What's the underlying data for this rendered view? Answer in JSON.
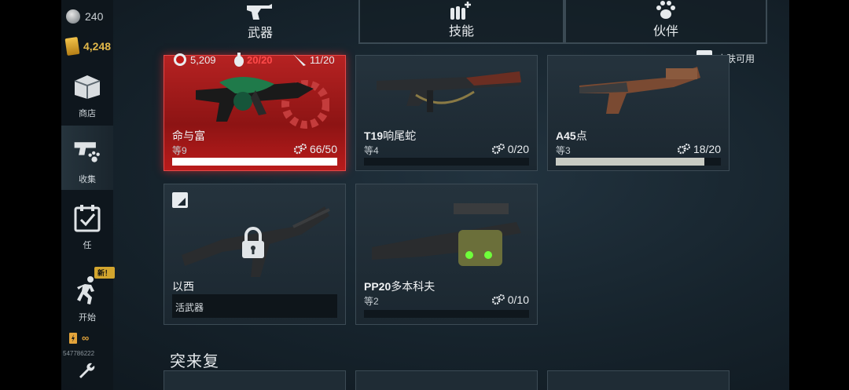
{
  "resources": {
    "silver": "240",
    "gold": "4,248"
  },
  "sidebar": {
    "items": [
      {
        "label": "商店",
        "icon": "shop-crate-icon"
      },
      {
        "label": "收集",
        "icon": "gun-paw-icon"
      },
      {
        "label": "任",
        "icon": "calendar-check-icon"
      },
      {
        "label": "开始",
        "icon": "running-man-icon"
      }
    ],
    "new_badge": "新！",
    "energy": "∞",
    "player_id": "547786222"
  },
  "tabs": [
    {
      "label": "武器",
      "icon": "revolver-icon"
    },
    {
      "label": "技能",
      "icon": "ammo-plus-icon"
    },
    {
      "label": "伙伴",
      "icon": "paw-icon"
    }
  ],
  "skin_available": "皮肤可用",
  "weapons": [
    {
      "name": "命与富",
      "level": "等9",
      "parts": "66/50",
      "progress": 1.0,
      "stats": {
        "damage": "5,209",
        "grenade": "20/20",
        "knife": "11/20"
      }
    },
    {
      "name_bold": "T19",
      "name_rest": "响尾蛇",
      "level": "等4",
      "parts": "0/20",
      "progress": 0
    },
    {
      "name_bold": "A45",
      "name_rest": "点",
      "level": "等3",
      "parts": "18/20",
      "progress": 0.9
    },
    {
      "name": "以西",
      "locked_text": "活武器"
    },
    {
      "name_bold": "PP20",
      "name_rest": "多本科夫",
      "level": "等2",
      "parts": "0/10",
      "progress": 0
    }
  ],
  "section_title": "突来复"
}
